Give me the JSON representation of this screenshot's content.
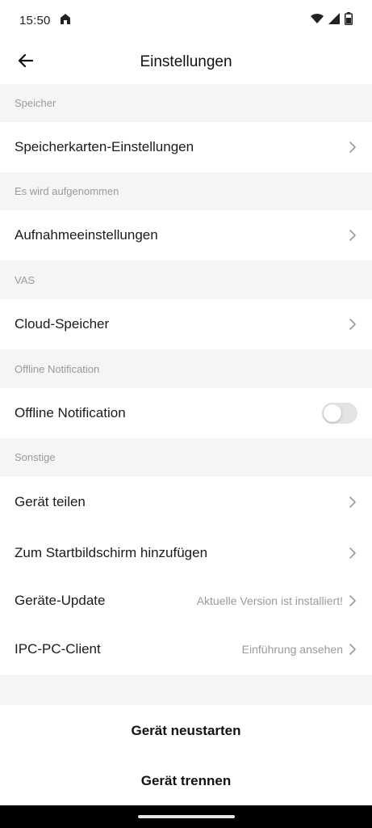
{
  "status_bar": {
    "time": "15:50"
  },
  "app_bar": {
    "title": "Einstellungen"
  },
  "sections": {
    "storage": {
      "header": "Speicher",
      "item": "Speicherkarten-Einstellungen"
    },
    "recording": {
      "header": "Es wird aufgenommen",
      "item": "Aufnahmeeinstellungen"
    },
    "vas": {
      "header": "VAS",
      "item": "Cloud-Speicher"
    },
    "offline": {
      "header": "Offline Notification",
      "item": "Offline Notification",
      "toggle_on": false
    },
    "other": {
      "header": "Sonstige",
      "share": "Gerät teilen",
      "home_screen": "Zum Startbildschirm hinzufügen",
      "update": {
        "label": "Geräte-Update",
        "value": "Aktuelle Version ist installiert!"
      },
      "pc_client": {
        "label": "IPC-PC-Client",
        "value": "Einführung ansehen"
      }
    }
  },
  "actions": {
    "restart": "Gerät neustarten",
    "disconnect": "Gerät trennen"
  },
  "colors": {
    "background": "#f5f5f5",
    "surface": "#ffffff",
    "secondary_text": "#9a9a9a",
    "toggle_off": "#e3e3e3"
  }
}
